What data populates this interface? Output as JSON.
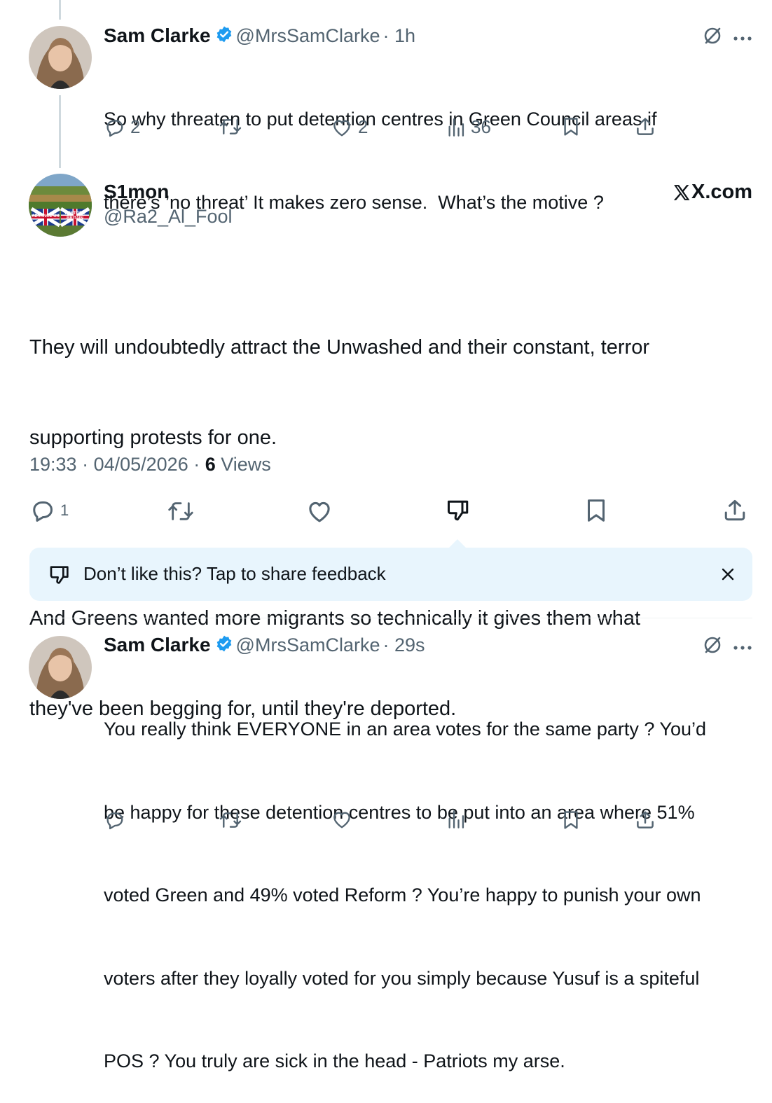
{
  "tweet1": {
    "name": "Sam Clarke",
    "handle": "@MrsSamClarke",
    "time": "· 1h",
    "text_lines": [
      "So why threaten to put detention centres in Green Council areas if",
      "there’s ’no threat’ It makes zero sense.  What’s the motive ?"
    ],
    "replies": "2",
    "likes": "2",
    "views": "36"
  },
  "main_tweet": {
    "name": "S1mon",
    "handle": "@Ra2_Al_Fool",
    "brand": "X.com",
    "avatar_banner_left": "ADVANCE UK",
    "avatar_banner_right": "RESTORE BRITAIN",
    "paragraph1_lines": [
      "They will undoubtedly attract the Unwashed and their constant, terror",
      "supporting protests for one."
    ],
    "paragraph2_lines": [
      "And Greens wanted more migrants so technically it gives them what",
      "they've been begging for, until they're deported."
    ],
    "time": "19:33",
    "date": "04/05/2026",
    "views_count": "6",
    "views_label": "Views",
    "replies": "1"
  },
  "feedback": {
    "text": "Don’t like this? Tap to share feedback"
  },
  "tweet2": {
    "name": "Sam Clarke",
    "handle": "@MrsSamClarke",
    "time": "· 29s",
    "text_lines": [
      "You really think EVERYONE in an area votes for the same party ? You’d",
      "be happy for these detention centres to be put into an area where 51%",
      "voted Green and 49% voted Reform ? You’re happy to punish your own",
      "voters after they loyally voted for you simply because Yusuf is a spiteful",
      "POS ? You truly are sick in the head - Patriots my arse."
    ]
  },
  "colors": {
    "text": "#0f1419",
    "secondary": "#536471",
    "verified": "#1d9bf0",
    "feedback_bg": "#e8f5fd"
  },
  "icons": [
    "reply-icon",
    "retweet-icon",
    "like-icon",
    "views-icon",
    "bookmark-icon",
    "share-icon",
    "grok-icon",
    "more-icon",
    "dislike-icon",
    "close-icon",
    "verified-icon",
    "x-logo"
  ]
}
